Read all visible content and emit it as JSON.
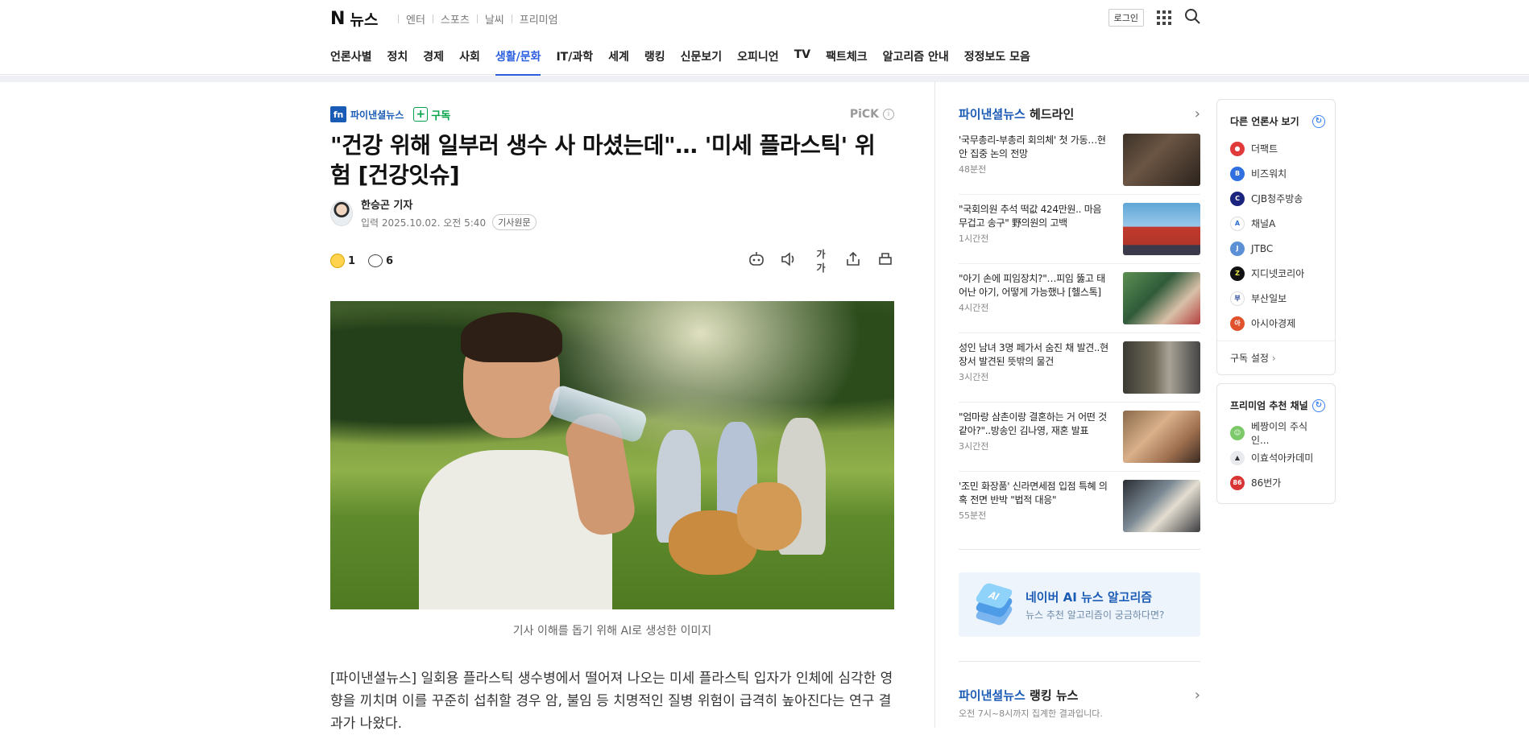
{
  "header": {
    "logo_mark": "N",
    "logo_text": "뉴스",
    "services": [
      "엔터",
      "스포츠",
      "날씨",
      "프리미엄"
    ],
    "login_label": "로그인"
  },
  "nav": {
    "items": [
      "언론사별",
      "정치",
      "경제",
      "사회",
      "생활/문화",
      "IT/과학",
      "세계",
      "랭킹",
      "신문보기",
      "오피니언",
      "TV",
      "팩트체크",
      "알고리즘 안내",
      "정정보도 모음"
    ],
    "active": "생활/문화"
  },
  "article": {
    "press_mark": "fn",
    "press_name": "파이낸셜뉴스",
    "subscribe_label": "구독",
    "pick_label": "PiCK",
    "pick_info": "i",
    "headline": "\"건강 위해 일부러 생수 사 마셨는데\"… '미세 플라스틱' 위험 [건강잇슈]",
    "reporter": "한승곤 기자",
    "date_line": "입력 2025.10.02. 오전 5:40",
    "original_label": "기사원문",
    "reaction_count": "1",
    "comment_count": "6",
    "tools": [
      "summary-icon",
      "audio-icon",
      "font-size-icon",
      "share-icon",
      "print-icon"
    ],
    "font_size_label": "가가",
    "caption": "기사 이해를 돕기 위해 AI로 생성한 이미지",
    "body": "[파이낸셜뉴스] 일회용 플라스틱 생수병에서 떨어져 나오는 미세 플라스틱 입자가 인체에 심각한 영향을 끼치며 이를 꾸준히 섭취할 경우 암, 불임 등 치명적인 질병 위험이 급격히 높아진다는 연구 결과가 나왔다."
  },
  "headlines": {
    "press": "파이낸셜뉴스",
    "title": "헤드라인",
    "items": [
      {
        "title": "'국무총리-부총리 회의체' 첫 가동…현안 집중 논의 전망",
        "time": "48분전"
      },
      {
        "title": "\"국회의원 추석 떡값 424만원.. 마음 무겁고 송구\" 野의원의 고백",
        "time": "1시간전"
      },
      {
        "title": "\"아기 손에 피임장치?\"…피임 뚫고 태어난 아기, 어떻게 가능했나 [헬스톡]",
        "time": "4시간전"
      },
      {
        "title": "성인 남녀 3명 페가서 숨진 채 발견..현장서 발견된 뜻밖의 물건",
        "time": "3시간전"
      },
      {
        "title": "\"엄마랑 삼촌이랑 결혼하는 거 어떤 것 같아?\"..방송인 김나영, 재혼 발표",
        "time": "3시간전"
      },
      {
        "title": "'조민 화장품' 신라면세점 입점 특혜 의혹 전면 반박 \"법적 대응\"",
        "time": "55분전"
      }
    ]
  },
  "ai_promo": {
    "icon_label": "AI",
    "title": "네이버 AI 뉴스 알고리즘",
    "subtitle": "뉴스 추천 알고리즘이 궁금하다면?"
  },
  "ranking": {
    "press": "파이낸셜뉴스",
    "title": "랭킹 뉴스",
    "subtitle": "오전 7시~8시까지 집계한 결과입니다."
  },
  "other_press": {
    "title": "다른 언론사 보기",
    "items": [
      {
        "name": "더팩트",
        "color": "#e03a3a"
      },
      {
        "name": "비즈워치",
        "color": "#2f6fe0"
      },
      {
        "name": "CJB청주방송",
        "color": "#1a237e"
      },
      {
        "name": "채널A",
        "color": "#ffffff"
      },
      {
        "name": "JTBC",
        "color": "#5b8fd6"
      },
      {
        "name": "지디넷코리아",
        "color": "#111111"
      },
      {
        "name": "부산일보",
        "color": "#ffffff"
      },
      {
        "name": "아시아경제",
        "color": "#e0522b"
      }
    ],
    "footer": "구독 설정"
  },
  "premium": {
    "title": "프리미엄 추천 채널",
    "items": [
      {
        "name": "베짱이의 주식 인...",
        "color": "#7cc96a"
      },
      {
        "name": "이효석아카데미",
        "color": "#e8eaee"
      },
      {
        "name": "86번가",
        "color": "#d93434"
      }
    ]
  },
  "colors": {
    "accent": "#2b5ee0",
    "press_blue": "#1a5bb5",
    "subscribe_green": "#00a34a"
  }
}
